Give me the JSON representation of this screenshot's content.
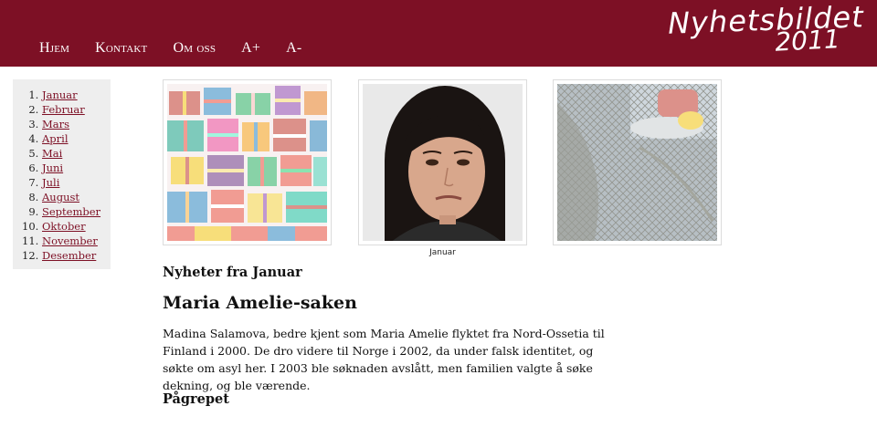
{
  "header": {
    "nav": [
      "Hjem",
      "Kontakt",
      "Om oss",
      "A+",
      "A-"
    ],
    "logo_line1": "Nyhetsbildet",
    "logo_line2": "2011",
    "brand_color": "#7d1025"
  },
  "sidebar": {
    "months": [
      "Januar",
      "Februar",
      "Mars",
      "April",
      "Mai",
      "Juni",
      "Juli",
      "August",
      "September",
      "Oktober",
      "November",
      "Desember"
    ]
  },
  "gallery": {
    "caption": "Januar"
  },
  "content": {
    "month_heading": "Nyheter fra Januar",
    "title": "Maria Amelie-saken",
    "body": "Madina Salamova, bedre kjent som Maria Amelie flyktet fra Nord-Ossetia til Finland i 2000. De dro videre til Norge i 2002, da under falsk identitet, og søkte om asyl her. I 2003 ble søknaden avslått, men familien valgte å søke dekning, og ble værende.",
    "subheading": "Pågrepet"
  }
}
